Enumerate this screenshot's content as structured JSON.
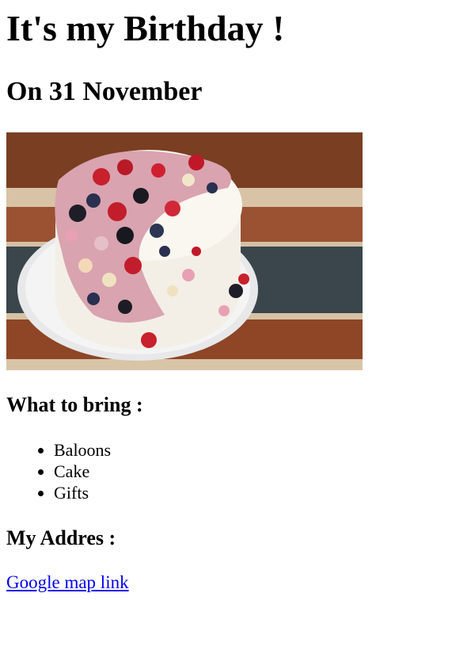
{
  "title": "It's my Birthday !",
  "subtitle": "On 31 November",
  "image": {
    "subject": "birthday cake with berries and piped frosting on wooden table"
  },
  "bring": {
    "heading": "What to bring :",
    "items": [
      "Baloons",
      "Cake",
      "Gifts"
    ]
  },
  "address": {
    "heading": "My Addres :",
    "link_text": "Google map link"
  },
  "colors": {
    "link": "#0000ee",
    "text": "#000000",
    "background": "#ffffff"
  }
}
